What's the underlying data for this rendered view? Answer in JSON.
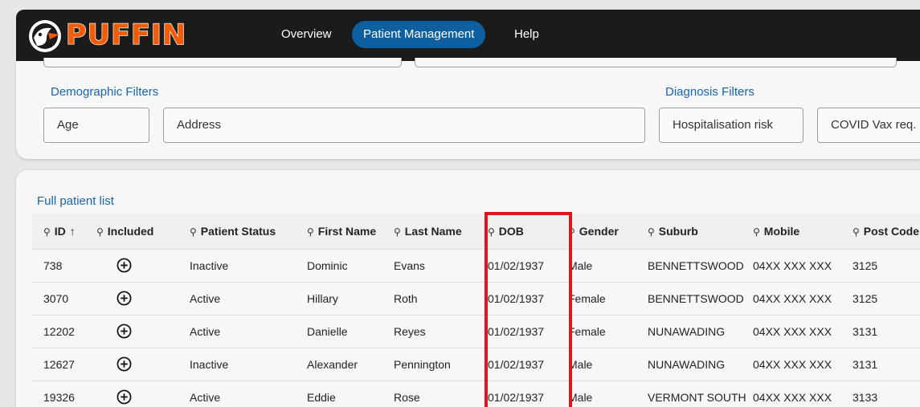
{
  "app": {
    "name": "PUFFIN"
  },
  "nav": {
    "items": [
      {
        "label": "Overview",
        "active": false
      },
      {
        "label": "Patient Management",
        "active": true
      },
      {
        "label": "Help",
        "active": false
      }
    ]
  },
  "filters": {
    "demographic_label": "Demographic Filters",
    "diagnosis_label": "Diagnosis Filters",
    "fields": {
      "age": "Age",
      "address": "Address",
      "hospitalisation_risk": "Hospitalisation risk",
      "covid_vax": "COVID Vax req."
    }
  },
  "table": {
    "title": "Full patient list",
    "sort_indicator": "↑",
    "search_glyph": "⚲",
    "columns": [
      {
        "key": "id",
        "label": "ID"
      },
      {
        "key": "included",
        "label": "Included"
      },
      {
        "key": "status",
        "label": "Patient Status"
      },
      {
        "key": "first",
        "label": "First Name"
      },
      {
        "key": "last",
        "label": "Last Name"
      },
      {
        "key": "dob",
        "label": "DOB"
      },
      {
        "key": "gender",
        "label": "Gender"
      },
      {
        "key": "suburb",
        "label": "Suburb"
      },
      {
        "key": "mobile",
        "label": "Mobile"
      },
      {
        "key": "postcode",
        "label": "Post Code"
      }
    ],
    "rows": [
      {
        "id": "738",
        "status": "Inactive",
        "first": "Dominic",
        "last": "Evans",
        "dob": "01/02/1937",
        "gender": "Male",
        "suburb": "BENNETTSWOOD",
        "mobile": "04XX XXX XXX",
        "postcode": "3125"
      },
      {
        "id": "3070",
        "status": "Active",
        "first": "Hillary",
        "last": "Roth",
        "dob": "01/02/1937",
        "gender": "Female",
        "suburb": "BENNETTSWOOD",
        "mobile": "04XX XXX XXX",
        "postcode": "3125"
      },
      {
        "id": "12202",
        "status": "Active",
        "first": "Danielle",
        "last": "Reyes",
        "dob": "01/02/1937",
        "gender": "Female",
        "suburb": "NUNAWADING",
        "mobile": "04XX XXX XXX",
        "postcode": "3131"
      },
      {
        "id": "12627",
        "status": "Inactive",
        "first": "Alexander",
        "last": "Pennington",
        "dob": "01/02/1937",
        "gender": "Male",
        "suburb": "NUNAWADING",
        "mobile": "04XX XXX XXX",
        "postcode": "3131"
      },
      {
        "id": "19326",
        "status": "Active",
        "first": "Eddie",
        "last": "Rose",
        "dob": "01/02/1937",
        "gender": "Male",
        "suburb": "VERMONT SOUTH",
        "mobile": "04XX XXX XXX",
        "postcode": "3133"
      }
    ]
  },
  "colors": {
    "brand_orange": "#f25c05",
    "nav_active": "#0d5fa0",
    "link_blue": "#1666ab",
    "highlight_red": "#e0141b",
    "topbar": "#1b1b1b"
  },
  "icons": {
    "logo": "puffin-logo-icon",
    "search": "search-icon",
    "include": "add-circle-icon"
  }
}
